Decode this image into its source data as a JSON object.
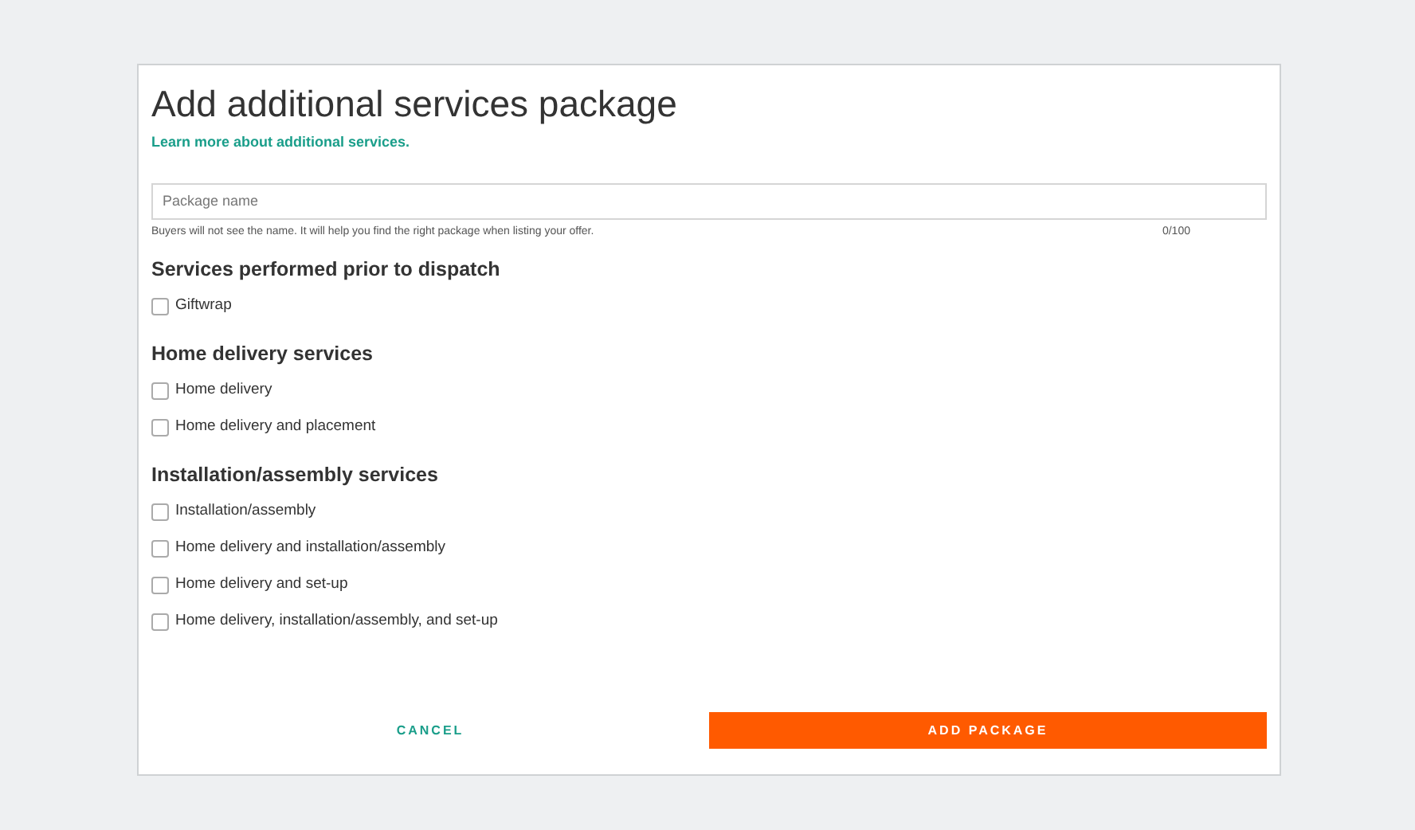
{
  "dialog": {
    "title": "Add additional services package",
    "link": "Learn more about additional services.",
    "package_name": {
      "placeholder": "Package name",
      "hint": "Buyers will not see the name. It will help you find the right package when listing your offer.",
      "counter": "0/100"
    },
    "sections": [
      {
        "heading": "Services performed prior to dispatch",
        "options": [
          {
            "label": "Giftwrap",
            "checked": false
          }
        ]
      },
      {
        "heading": "Home delivery services",
        "options": [
          {
            "label": "Home delivery",
            "checked": false
          },
          {
            "label": "Home delivery and placement",
            "checked": false
          }
        ]
      },
      {
        "heading": "Installation/assembly services",
        "options": [
          {
            "label": "Installation/assembly",
            "checked": false
          },
          {
            "label": "Home delivery and installation/assembly",
            "checked": false
          },
          {
            "label": "Home delivery and set-up",
            "checked": false
          },
          {
            "label": "Home delivery, installation/assembly, and set-up",
            "checked": false
          }
        ]
      }
    ],
    "buttons": {
      "cancel": "CANCEL",
      "submit": "ADD PACKAGE"
    }
  }
}
